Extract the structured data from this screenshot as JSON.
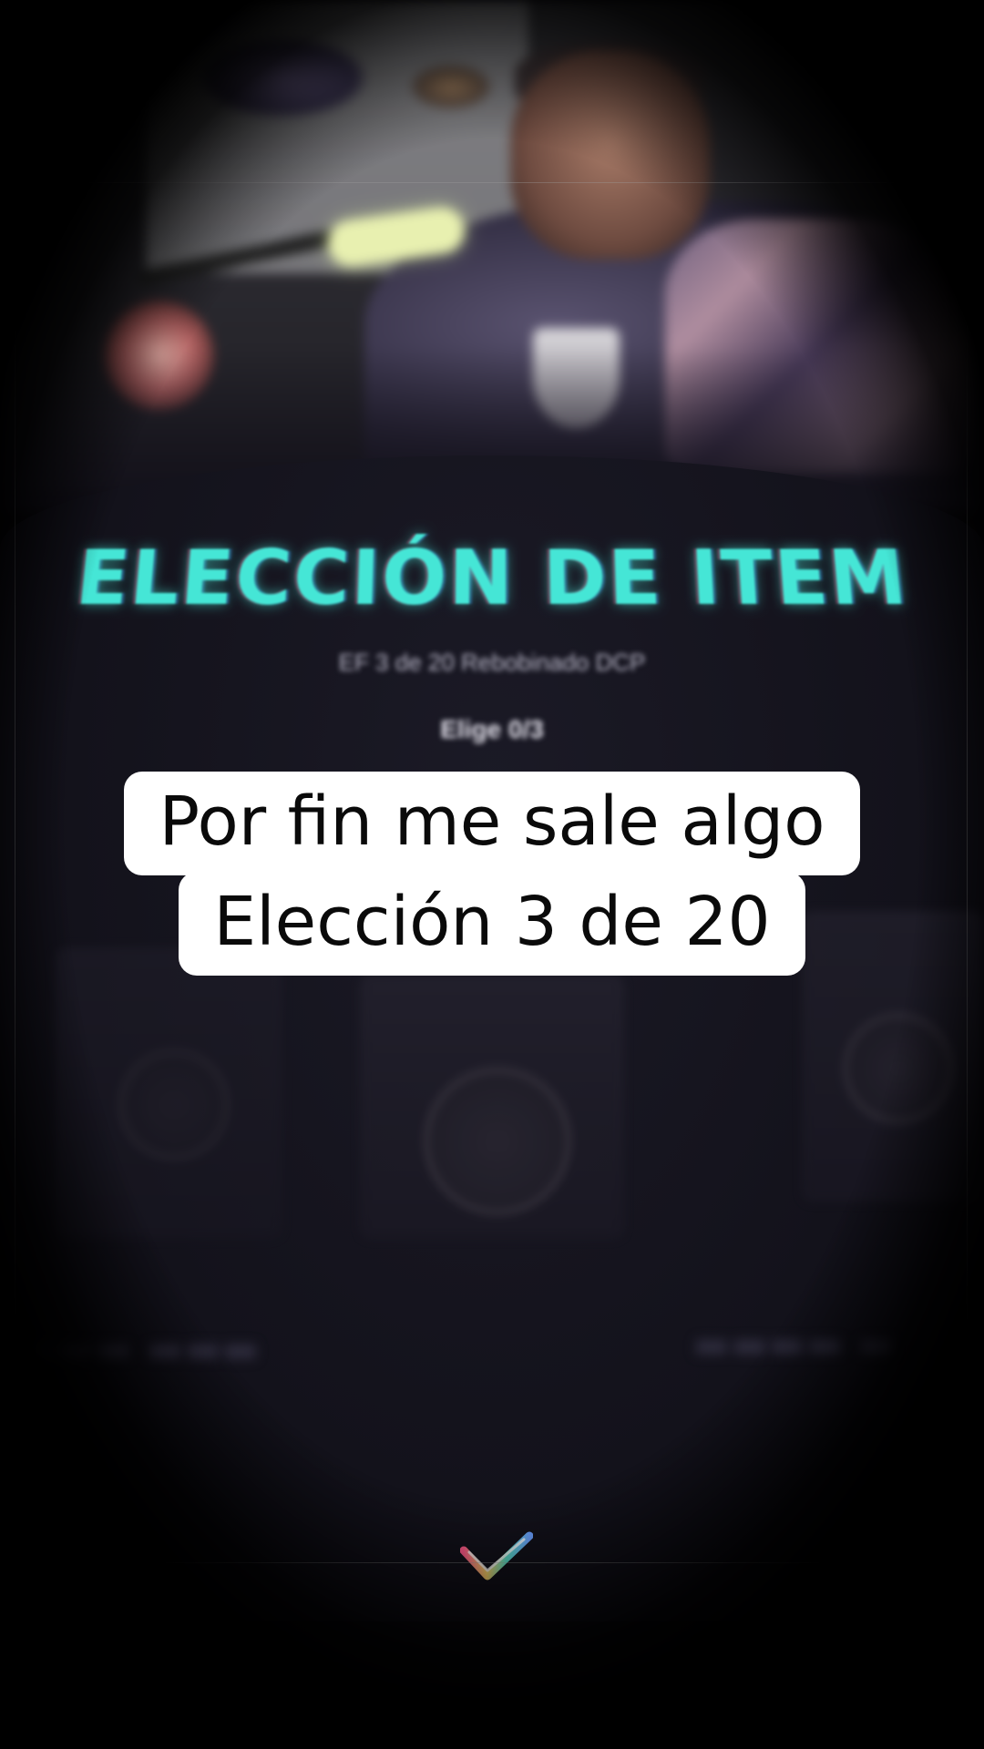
{
  "game": {
    "title": "ELECCIÓN DE ITEM",
    "subtitle": "EF 3 de 20 Rebobinado DCP",
    "pick_count": "Elige 0/3"
  },
  "caption": {
    "line1": "Por fin me sale algo",
    "line2": "Elección 3 de 20"
  },
  "colors": {
    "title_accent": "#45e6d6",
    "caption_bg": "#ffffff",
    "caption_text": "#0a0a0a"
  },
  "icons": {
    "brand": "chevron-logo-icon"
  }
}
